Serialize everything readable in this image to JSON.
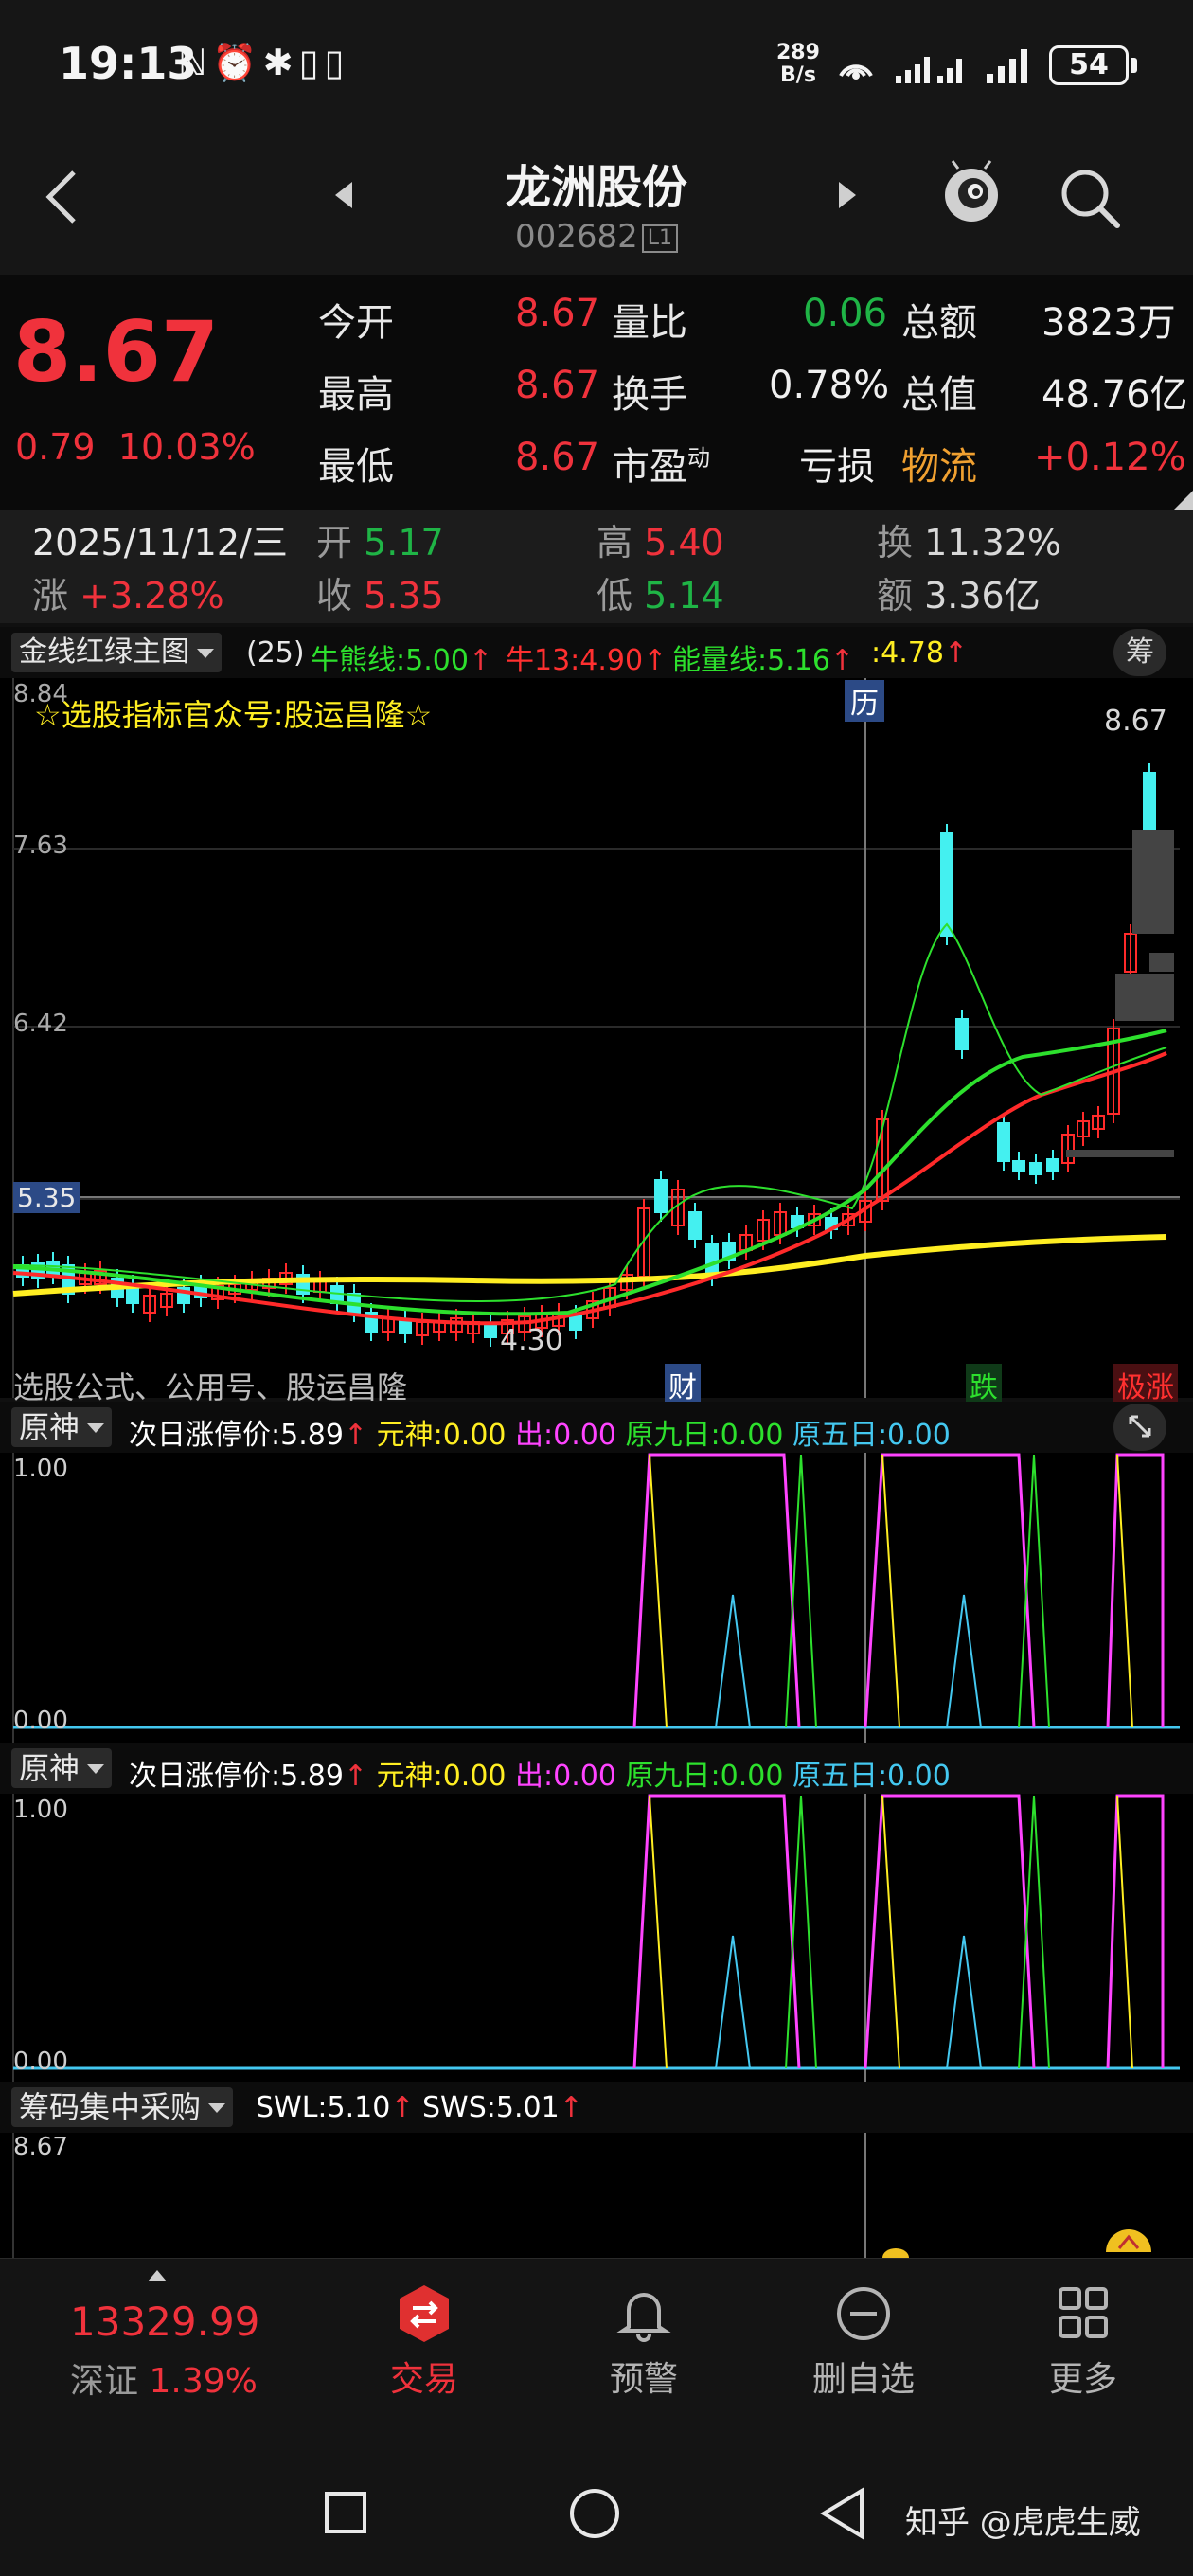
{
  "status_bar": {
    "time": "19:13",
    "icons_left": "ℕ⏰✱▯▯",
    "net_speed_value": "289",
    "net_speed_unit": "B/s",
    "signal": "ıl ıl",
    "battery": "54"
  },
  "header": {
    "title": "龙洲股份",
    "code": "002682",
    "level_badge": "L1"
  },
  "quote": {
    "price": "8.67",
    "change": "0.79",
    "change_pct": "10.03%",
    "rows": [
      {
        "l1": "今开",
        "v1": "8.67",
        "l2": "量比",
        "v2": "0.06",
        "l3": "总额",
        "v3": "3823万"
      },
      {
        "l1": "最高",
        "v1": "8.67",
        "l2": "换手",
        "v2": "0.78%",
        "l3": "总值",
        "v3": "48.76亿"
      },
      {
        "l1": "最低",
        "v1": "8.67",
        "l2": "市盈",
        "l2sup": "动",
        "v2": "亏损",
        "l3": "物流",
        "v3": "+0.12%"
      }
    ]
  },
  "info_row": {
    "date": "2025/11/12/三",
    "open_label": "开",
    "open": "5.17",
    "high_label": "高",
    "high": "5.40",
    "turnover_label": "换",
    "turnover": "11.32%",
    "chg_label": "涨",
    "chg": "+3.28%",
    "close_label": "收",
    "close": "5.35",
    "low_label": "低",
    "low": "5.14",
    "amount_label": "额",
    "amount": "3.36亿"
  },
  "main_indicator": {
    "dropdown": "金线红绿主图",
    "period": "(25)",
    "bull_bear": "牛熊线:5.00",
    "bull13": "牛13:4.90",
    "energy": "能量线:5.16",
    "extra": ":4.78",
    "chip_button": "筹"
  },
  "main_chart": {
    "y_top": "8.84",
    "y_ticks": [
      "7.63",
      "6.42"
    ],
    "cross_value": "5.35",
    "last_price": "8.67",
    "low_mark": "4.30",
    "promo": "☆选股指标官众号:股运昌隆☆",
    "footer": "选股公式、公用号、股运昌隆",
    "history_tag": "历",
    "tag_fin": "财",
    "tag_down": "跌",
    "tag_limit": "极涨",
    "colors": {
      "yellow": "#ffee22",
      "red": "#ff2a2a",
      "green": "#2de02d",
      "cyan": "#44f0f0"
    }
  },
  "panels": [
    {
      "dropdown": "原神",
      "items": [
        {
          "text": "次日涨停价:5.89",
          "color": "#ffffff"
        },
        {
          "text": "元神:0.00",
          "color": "#ffee22"
        },
        {
          "text": "出:0.00",
          "color": "#ff44ff"
        },
        {
          "text": "原九日:0.00",
          "color": "#2de02d"
        },
        {
          "text": "原五日:0.00",
          "color": "#44c8f0"
        }
      ],
      "y_top": "1.00",
      "y_bottom": "0.00"
    },
    {
      "dropdown": "原神",
      "items": [
        {
          "text": "次日涨停价:5.89",
          "color": "#ffffff"
        },
        {
          "text": "元神:0.00",
          "color": "#ffee22"
        },
        {
          "text": "出:0.00",
          "color": "#ff44ff"
        },
        {
          "text": "原九日:0.00",
          "color": "#2de02d"
        },
        {
          "text": "原五日:0.00",
          "color": "#44c8f0"
        }
      ],
      "y_top": "1.00",
      "y_bottom": "0.00"
    }
  ],
  "chip_panel": {
    "dropdown": "筹码集中采购",
    "swl": "SWL:5.10",
    "sws": "SWS:5.01",
    "y_top": "8.67"
  },
  "bottom_nav": {
    "index_value": "13329.99",
    "index_name": "深证",
    "index_pct": "1.39%",
    "items": [
      "交易",
      "预警",
      "删自选",
      "更多"
    ]
  },
  "watermark": "知乎 @虎虎生威"
}
